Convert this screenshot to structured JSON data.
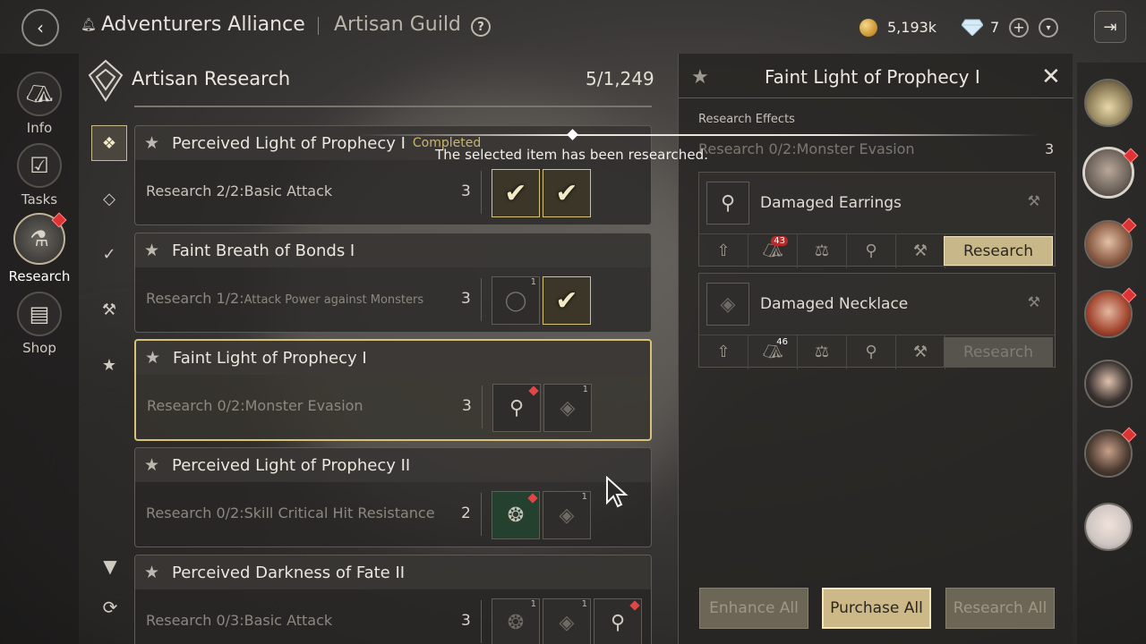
{
  "header": {
    "breadcrumb_main": "Adventurers Alliance",
    "breadcrumb_sub": "Artisan Guild",
    "help": "?",
    "gold": "5,193k",
    "gems": "7",
    "plus": "+",
    "dropdown": "▾"
  },
  "nav": {
    "items": [
      {
        "label": "Info",
        "icon": "tent-icon"
      },
      {
        "label": "Tasks",
        "icon": "checklist-icon"
      },
      {
        "label": "Research",
        "icon": "flask-icon"
      },
      {
        "label": "Shop",
        "icon": "chest-icon"
      }
    ]
  },
  "research": {
    "title": "Artisan Research",
    "count": "5/1,249",
    "toast": "The selected item has been researched.",
    "cards": [
      {
        "title": "Perceived Light of Prophecy I",
        "status": "Completed",
        "research": "Research 2/2:Basic Attack",
        "level": "3"
      },
      {
        "title": "Faint Breath of Bonds I",
        "research_prefix": "Research 1/2:",
        "research_small": "Attack Power against Monsters",
        "level": "3"
      },
      {
        "title": "Faint Light of Prophecy I",
        "research": "Research 0/2:Monster Evasion",
        "level": "3"
      },
      {
        "title": "Perceived Light of Prophecy II",
        "research": "Research 0/2:Skill Critical Hit Resistance",
        "level": "2"
      },
      {
        "title": "Perceived Darkness of Fate II",
        "research": "Research 0/3:Basic Attack",
        "level": "3"
      }
    ],
    "slot_num": "1"
  },
  "detail": {
    "title": "Faint Light of Prophecy I",
    "close": "✕",
    "effects_label": "Research Effects",
    "effect": "Research 0/2:Monster Evasion",
    "effect_level": "3",
    "materials": [
      {
        "name": "Damaged Earrings",
        "count": "43",
        "button": "Research"
      },
      {
        "name": "Damaged Necklace",
        "count": "46",
        "button": "Research"
      }
    ],
    "enhance_all": "Enhance All",
    "purchase_all": "Purchase All",
    "research_all": "Research All"
  }
}
